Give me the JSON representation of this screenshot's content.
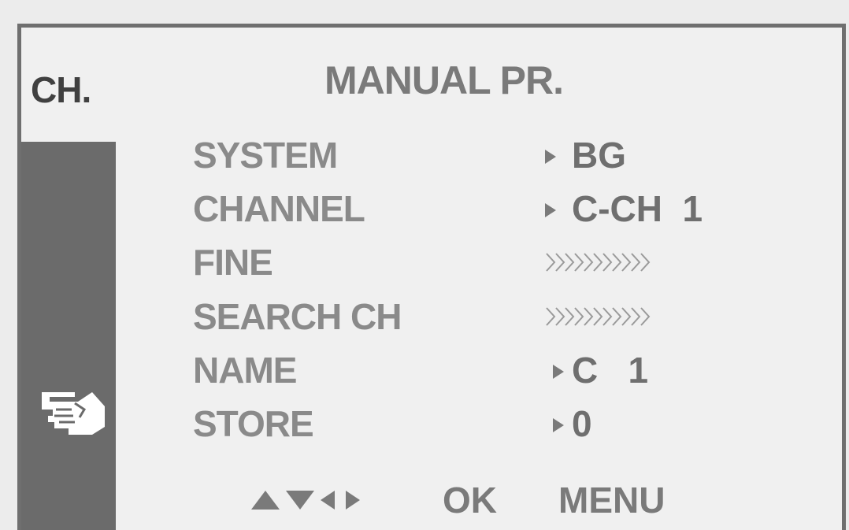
{
  "menu": {
    "tab": "CH.",
    "title": "MANUAL PR.",
    "rows": [
      {
        "label": "SYSTEM",
        "value": "BG",
        "type": "select"
      },
      {
        "label": "CHANNEL",
        "value": "C-CH  1",
        "type": "select"
      },
      {
        "label": "FINE",
        "value": "",
        "type": "adjust"
      },
      {
        "label": "SEARCH CH",
        "value": "",
        "type": "adjust"
      },
      {
        "label": "NAME",
        "value": "C   1",
        "type": "select"
      },
      {
        "label": "STORE",
        "value": "0",
        "type": "select"
      }
    ]
  },
  "footer": {
    "ok_label": "OK",
    "menu_label": "MENU"
  },
  "icons": {
    "pointer": "hand-pointer-icon",
    "value_arrow": "triangle-right-icon",
    "adjust": "chevron-track-icon",
    "nav": "up-down-left-right-arrows-icon"
  },
  "colors": {
    "background": "#f0f0f0",
    "sidebar": "#6b6b6b",
    "text": "#8a8a8a"
  }
}
